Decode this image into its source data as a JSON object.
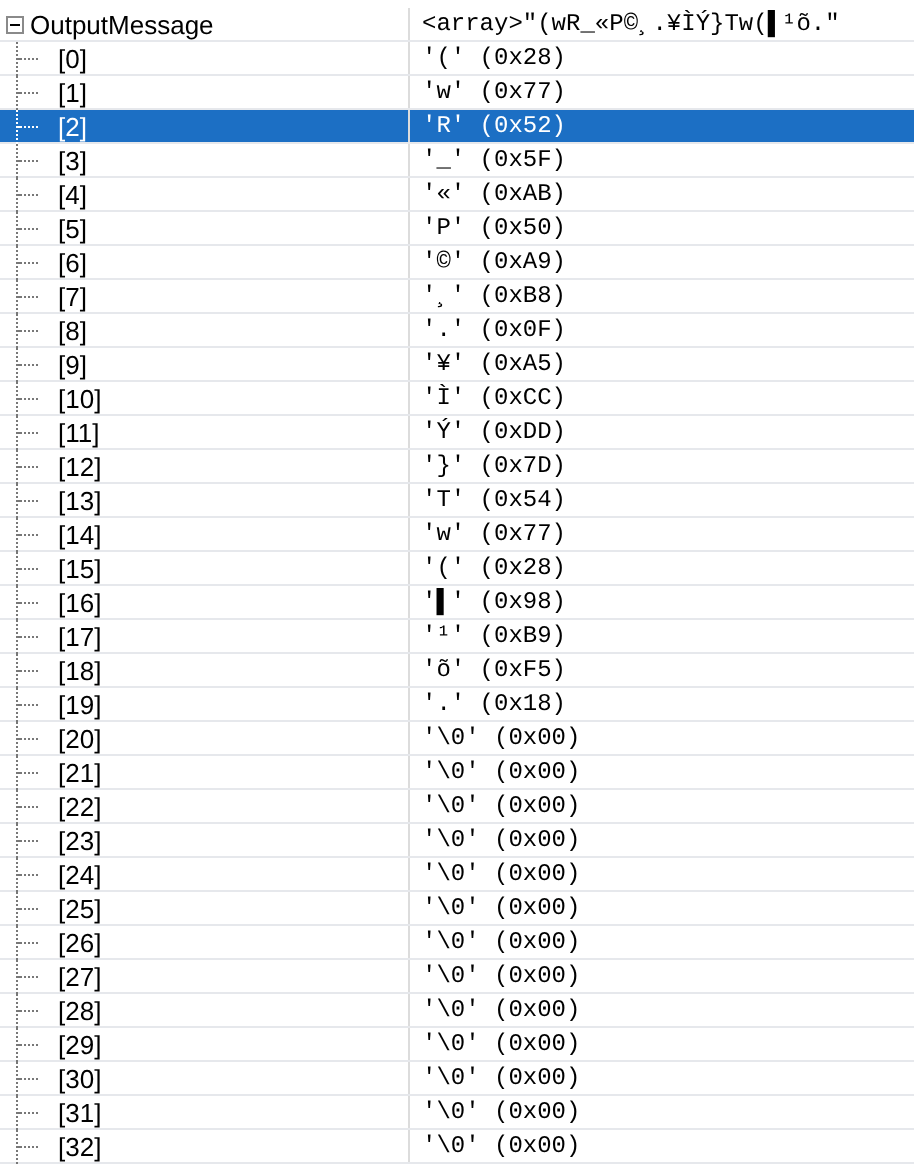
{
  "root": {
    "name": "OutputMessage",
    "value": "<array>\"(wR_«P©¸.¥ÌÝ}Tw(▌¹õ.\"",
    "expanded": true,
    "children": [
      {
        "name": "[0]",
        "value": "'(' (0x28)",
        "selected": false
      },
      {
        "name": "[1]",
        "value": "'w' (0x77)",
        "selected": false
      },
      {
        "name": "[2]",
        "value": "'R' (0x52)",
        "selected": true
      },
      {
        "name": "[3]",
        "value": "'_' (0x5F)",
        "selected": false
      },
      {
        "name": "[4]",
        "value": "'«' (0xAB)",
        "selected": false
      },
      {
        "name": "[5]",
        "value": "'P' (0x50)",
        "selected": false
      },
      {
        "name": "[6]",
        "value": "'©' (0xA9)",
        "selected": false
      },
      {
        "name": "[7]",
        "value": "'¸' (0xB8)",
        "selected": false
      },
      {
        "name": "[8]",
        "value": "'.' (0x0F)",
        "selected": false
      },
      {
        "name": "[9]",
        "value": "'¥' (0xA5)",
        "selected": false
      },
      {
        "name": "[10]",
        "value": "'Ì' (0xCC)",
        "selected": false
      },
      {
        "name": "[11]",
        "value": "'Ý' (0xDD)",
        "selected": false
      },
      {
        "name": "[12]",
        "value": "'}' (0x7D)",
        "selected": false
      },
      {
        "name": "[13]",
        "value": "'T' (0x54)",
        "selected": false
      },
      {
        "name": "[14]",
        "value": "'w' (0x77)",
        "selected": false
      },
      {
        "name": "[15]",
        "value": "'(' (0x28)",
        "selected": false
      },
      {
        "name": "[16]",
        "value": "'▌' (0x98)",
        "selected": false
      },
      {
        "name": "[17]",
        "value": "'¹' (0xB9)",
        "selected": false
      },
      {
        "name": "[18]",
        "value": "'õ' (0xF5)",
        "selected": false
      },
      {
        "name": "[19]",
        "value": "'.' (0x18)",
        "selected": false
      },
      {
        "name": "[20]",
        "value": "'\\0' (0x00)",
        "selected": false
      },
      {
        "name": "[21]",
        "value": "'\\0' (0x00)",
        "selected": false
      },
      {
        "name": "[22]",
        "value": "'\\0' (0x00)",
        "selected": false
      },
      {
        "name": "[23]",
        "value": "'\\0' (0x00)",
        "selected": false
      },
      {
        "name": "[24]",
        "value": "'\\0' (0x00)",
        "selected": false
      },
      {
        "name": "[25]",
        "value": "'\\0' (0x00)",
        "selected": false
      },
      {
        "name": "[26]",
        "value": "'\\0' (0x00)",
        "selected": false
      },
      {
        "name": "[27]",
        "value": "'\\0' (0x00)",
        "selected": false
      },
      {
        "name": "[28]",
        "value": "'\\0' (0x00)",
        "selected": false
      },
      {
        "name": "[29]",
        "value": "'\\0' (0x00)",
        "selected": false
      },
      {
        "name": "[30]",
        "value": "'\\0' (0x00)",
        "selected": false
      },
      {
        "name": "[31]",
        "value": "'\\0' (0x00)",
        "selected": false
      },
      {
        "name": "[32]",
        "value": "'\\0' (0x00)",
        "selected": false
      }
    ]
  }
}
